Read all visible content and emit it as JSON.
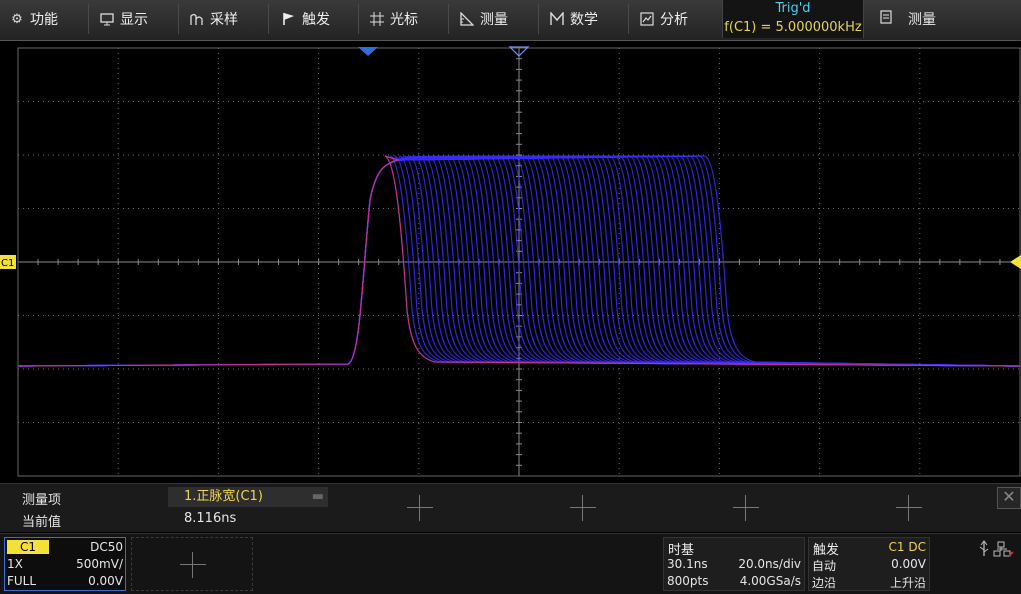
{
  "menu": [
    {
      "label": "功能",
      "icon": "gear-icon"
    },
    {
      "label": "显示",
      "icon": "monitor-icon"
    },
    {
      "label": "采样",
      "icon": "sampling-icon"
    },
    {
      "label": "触发",
      "icon": "flag-icon"
    },
    {
      "label": "光标",
      "icon": "cursor-icon"
    },
    {
      "label": "测量",
      "icon": "ruler-icon"
    },
    {
      "label": "数学",
      "icon": "math-icon"
    },
    {
      "label": "分析",
      "icon": "analysis-icon"
    }
  ],
  "status": {
    "trig": "Trig'd",
    "freq": "f(C1) = 5.000000kHz"
  },
  "measure_button": {
    "label": "测量",
    "icon": "clipboard-icon"
  },
  "channel_marker": "C1",
  "measurement": {
    "col_header": "测量项",
    "row_label": "当前值",
    "item_name": "1.正脉宽(C1)",
    "item_value": "8.116ns",
    "dash": "▬"
  },
  "channel1": {
    "name": "C1",
    "coupling": "DC50",
    "probe": "1X",
    "scale": "500mV/",
    "bandwidth": "FULL",
    "offset": "0.00V"
  },
  "timebase": {
    "title": "时基",
    "delay": "30.1ns",
    "scale": "20.0ns/div",
    "points": "800pts",
    "rate": "4.00GSa/s"
  },
  "trigger": {
    "title": "触发",
    "source": "C1 DC",
    "mode": "自动",
    "level": "0.00V",
    "type_label": "边沿",
    "slope": "上升沿"
  },
  "colors": {
    "trace": "#3a2cff",
    "trace_edge": "#d6337a",
    "grid": "#6a6a6a",
    "c1": "#f5e03a",
    "trig_blue": "#2f6fd6",
    "trig_cyan": "#4dd2e8"
  }
}
